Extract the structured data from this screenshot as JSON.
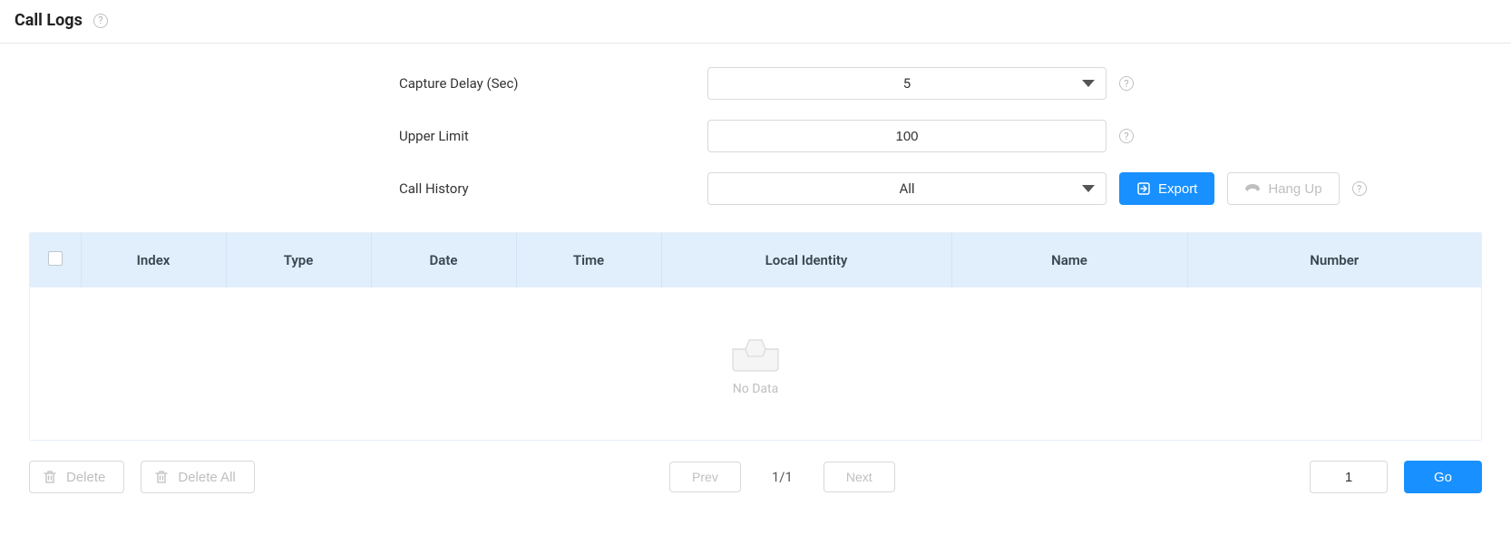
{
  "header": {
    "title": "Call Logs"
  },
  "form": {
    "capture_delay_label": "Capture Delay (Sec)",
    "capture_delay_value": "5",
    "upper_limit_label": "Upper Limit",
    "upper_limit_value": "100",
    "call_history_label": "Call History",
    "call_history_value": "All",
    "export_label": "Export",
    "hangup_label": "Hang Up"
  },
  "table": {
    "columns": {
      "index": "Index",
      "type": "Type",
      "date": "Date",
      "time": "Time",
      "local_identity": "Local Identity",
      "name": "Name",
      "number": "Number"
    },
    "empty_text": "No Data"
  },
  "footer": {
    "delete_label": "Delete",
    "delete_all_label": "Delete All",
    "prev_label": "Prev",
    "next_label": "Next",
    "page_text": "1/1",
    "page_input_value": "1",
    "go_label": "Go"
  }
}
